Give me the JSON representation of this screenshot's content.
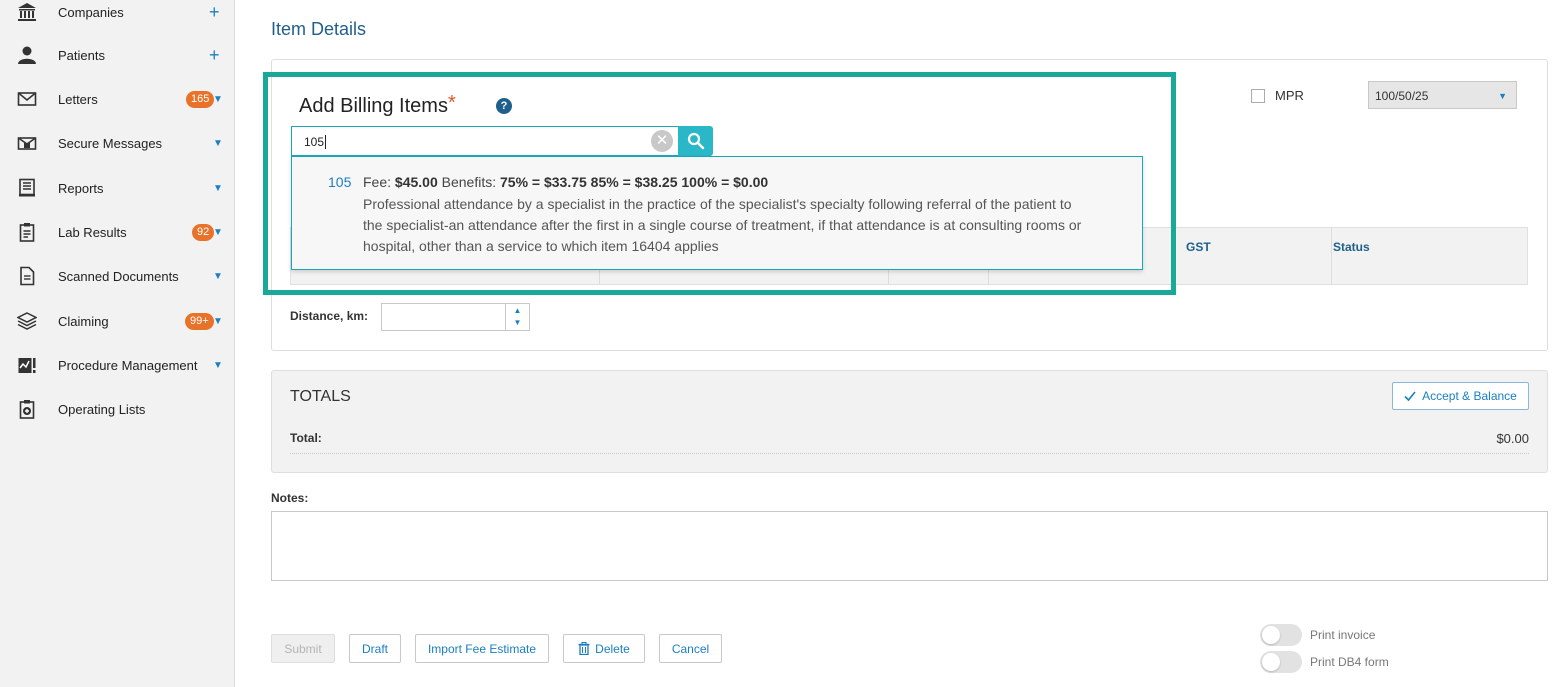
{
  "sidebar": {
    "items": [
      {
        "label": "Companies",
        "icon": "bank-icon",
        "suffix": "+"
      },
      {
        "label": "Patients",
        "icon": "person-icon",
        "suffix": "+"
      },
      {
        "label": "Letters",
        "icon": "envelope-icon",
        "badge": "165"
      },
      {
        "label": "Secure Messages",
        "icon": "secure-mail-icon"
      },
      {
        "label": "Reports",
        "icon": "report-icon"
      },
      {
        "label": "Lab Results",
        "icon": "clipboard-icon",
        "badge": "92"
      },
      {
        "label": "Scanned Documents",
        "icon": "document-icon"
      },
      {
        "label": "Claiming",
        "icon": "layers-icon",
        "badge": "99+"
      },
      {
        "label": "Procedure Management",
        "icon": "chart-icon"
      },
      {
        "label": "Operating Lists",
        "icon": "medical-clipboard-icon"
      }
    ],
    "arrow": "▼"
  },
  "main": {
    "title": "Item Details",
    "mpr_label": "MPR",
    "select_value": "100/50/25",
    "add_billing_title": "Add Billing Items",
    "required_mark": "*",
    "help": "?",
    "search_value": "105",
    "dropdown": {
      "code": "105",
      "fee_label": "Fee:",
      "fee_value": "$45.00",
      "benefits_label": "Benefits:",
      "benefits_value": "75% = $33.75 85% = $38.25 100% = $0.00",
      "description": "Professional attendance by a specialist in the practice of the specialist's specialty following referral of the patient to the specialist-an attendance after the first in a single course of treatment, if that attendance is at consulting rooms or hospital, other than a service to which item 16404 applies"
    },
    "table_headers": {
      "gst": "GST",
      "status": "Status"
    },
    "distance_label": "Distance, km:",
    "totals": {
      "title": "TOTALS",
      "accept_label": "Accept & Balance",
      "total_label": "Total:",
      "total_value": "$0.00"
    },
    "notes_label": "Notes:",
    "buttons": {
      "submit": "Submit",
      "draft": "Draft",
      "import": "Import Fee Estimate",
      "delete": "Delete",
      "cancel": "Cancel"
    },
    "toggles": {
      "print_invoice": "Print invoice",
      "print_db4": "Print DB4 form"
    }
  },
  "colors": {
    "accent": "#1a7fc1",
    "highlight": "#1aa898",
    "badge": "#e8722a"
  }
}
